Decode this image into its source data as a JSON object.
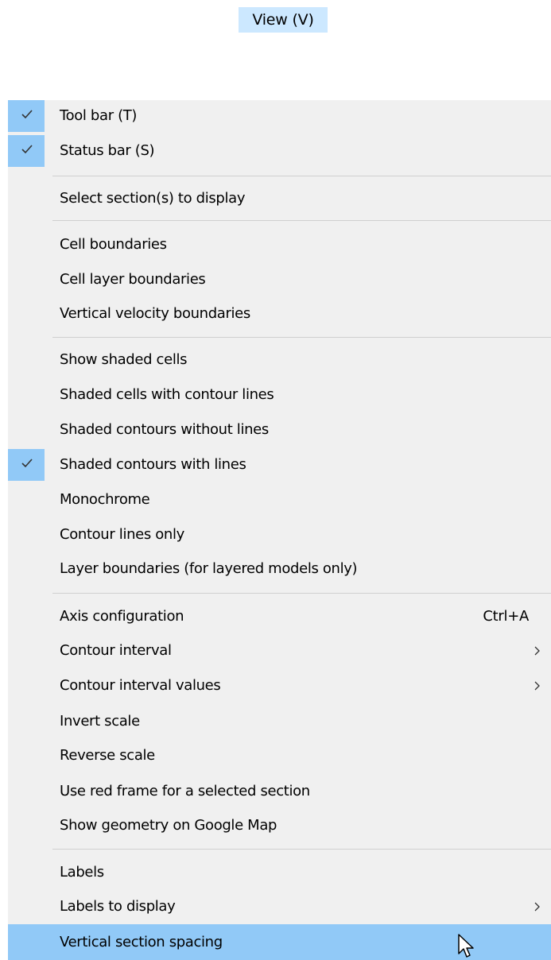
{
  "menubar": {
    "view_label": "View (V)"
  },
  "menu": {
    "tool_bar": "Tool bar (T)",
    "status_bar": "Status bar (S)",
    "select_sections": "Select section(s) to display",
    "cell_boundaries": "Cell boundaries",
    "cell_layer_boundaries": "Cell layer boundaries",
    "vertical_velocity_boundaries": "Vertical velocity boundaries",
    "show_shaded_cells": "Show shaded cells",
    "shaded_cells_contour_lines": "Shaded cells with contour lines",
    "shaded_contours_without_lines": "Shaded contours without lines",
    "shaded_contours_with_lines": "Shaded contours with lines",
    "monochrome": "Monochrome",
    "contour_lines_only": "Contour lines only",
    "layer_boundaries": "Layer boundaries (for layered models only)",
    "axis_configuration": "Axis configuration",
    "axis_configuration_shortcut": "Ctrl+A",
    "contour_interval": "Contour interval",
    "contour_interval_values": "Contour interval values",
    "invert_scale": "Invert scale",
    "reverse_scale": "Reverse scale",
    "use_red_frame": "Use red frame for a selected section",
    "show_geometry_google_map": "Show geometry on Google Map",
    "labels": "Labels",
    "labels_to_display": "Labels to display",
    "vertical_section_spacing": "Vertical section spacing"
  },
  "checked": {
    "tool_bar": true,
    "status_bar": true,
    "shaded_contours_with_lines": true
  },
  "hovered_item": "Vertical section spacing",
  "colors": {
    "menu_background": "#f0f0f0",
    "highlight": "#91c9f7",
    "menubar_highlight": "#cce8ff",
    "separator": "#cfcfcf"
  }
}
